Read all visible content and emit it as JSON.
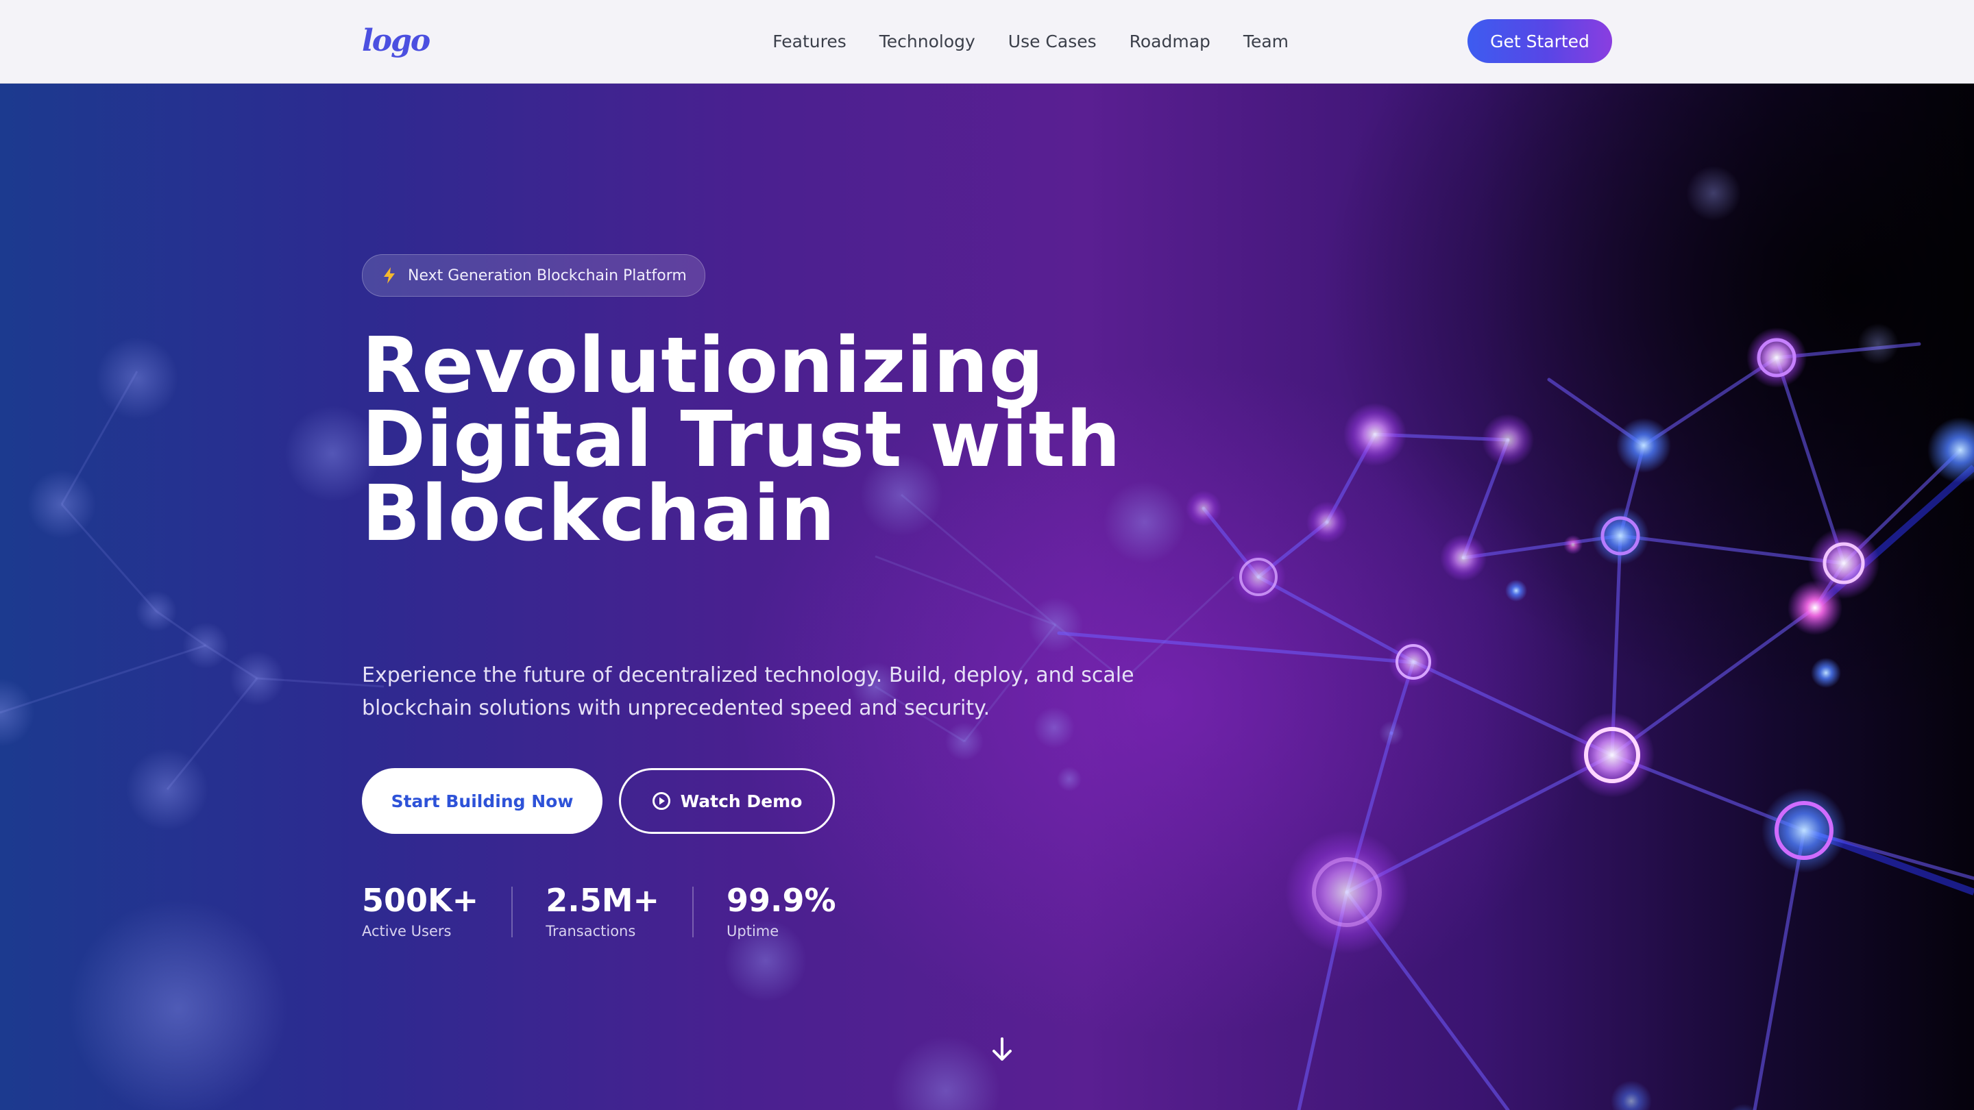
{
  "nav": {
    "logo_text": "logo",
    "links": [
      "Features",
      "Technology",
      "Use Cases",
      "Roadmap",
      "Team"
    ],
    "cta_label": "Get Started"
  },
  "hero": {
    "badge_text": "Next Generation Blockchain Platform",
    "headline_lines": [
      "Revolutionizing",
      "Digital Trust with",
      "Blockchain"
    ],
    "subtitle": "Experience the future of decentralized technology. Build, deploy, and scale blockchain solutions with unprecedented speed and security.",
    "primary_button": "Start Building Now",
    "secondary_button": "Watch Demo",
    "stats": [
      {
        "value": "500K+",
        "label": "Active Users"
      },
      {
        "value": "2.5M+",
        "label": "Transactions"
      },
      {
        "value": "99.9%",
        "label": "Uptime"
      }
    ]
  },
  "icons": {
    "badge": "lightning-icon",
    "demo": "play-circle-icon",
    "scroll": "arrow-down-icon"
  },
  "colors": {
    "accent_blue": "#3d5cf0",
    "accent_purple": "#8a3ee0",
    "badge_bolt": "#f5b82e",
    "primary_button_text": "#2d52d8"
  }
}
